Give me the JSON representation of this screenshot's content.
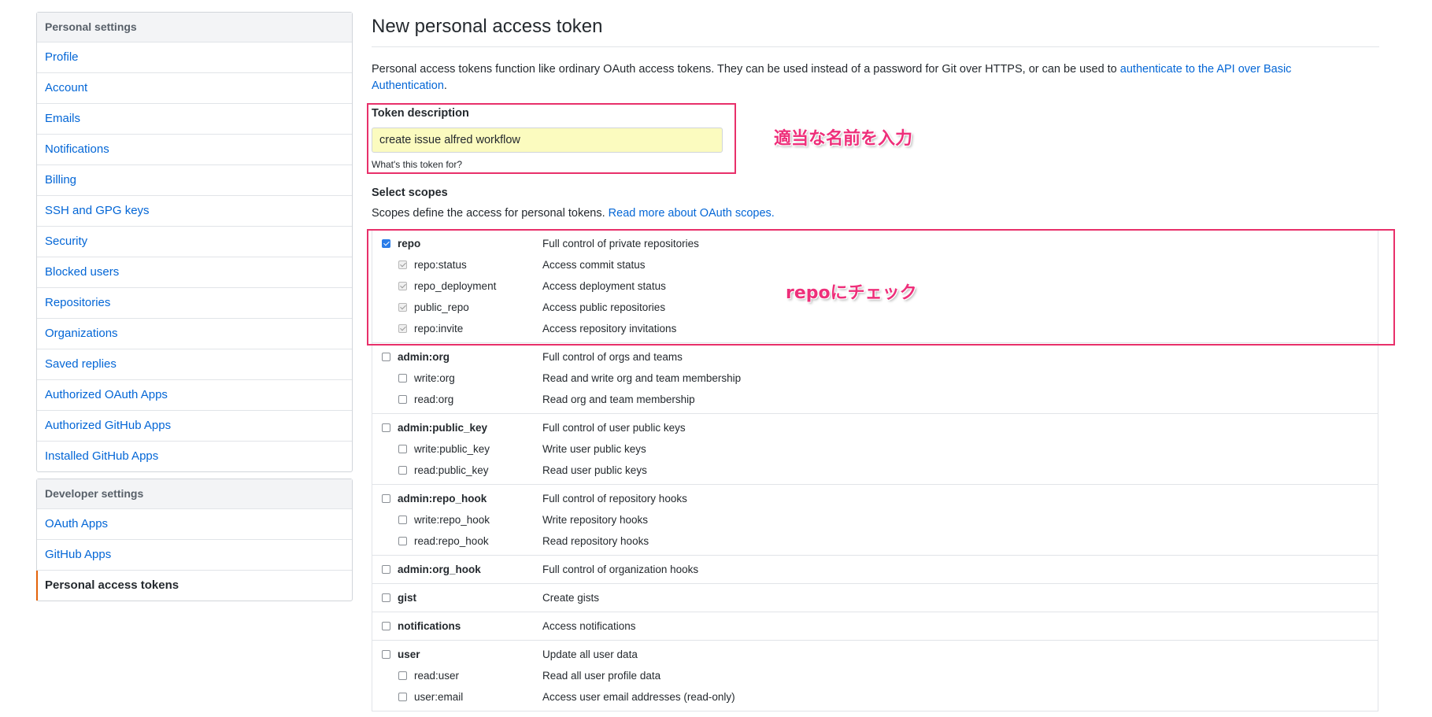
{
  "sidebar": {
    "personal_heading": "Personal settings",
    "personal_items": [
      {
        "label": "Profile"
      },
      {
        "label": "Account"
      },
      {
        "label": "Emails"
      },
      {
        "label": "Notifications"
      },
      {
        "label": "Billing"
      },
      {
        "label": "SSH and GPG keys"
      },
      {
        "label": "Security"
      },
      {
        "label": "Blocked users"
      },
      {
        "label": "Repositories"
      },
      {
        "label": "Organizations"
      },
      {
        "label": "Saved replies"
      },
      {
        "label": "Authorized OAuth Apps"
      },
      {
        "label": "Authorized GitHub Apps"
      },
      {
        "label": "Installed GitHub Apps"
      }
    ],
    "developer_heading": "Developer settings",
    "developer_items": [
      {
        "label": "OAuth Apps"
      },
      {
        "label": "GitHub Apps"
      },
      {
        "label": "Personal access tokens",
        "selected": true
      }
    ]
  },
  "main": {
    "title": "New personal access token",
    "intro_text": "Personal access tokens function like ordinary OAuth access tokens. They can be used instead of a password for Git over HTTPS, or can be used to ",
    "intro_link": "authenticate to the API over Basic Authentication",
    "intro_end": ".",
    "token_description_label": "Token description",
    "token_description_value": "create issue alfred workflow",
    "token_description_note": "What's this token for?",
    "select_scopes_label": "Select scopes",
    "scopes_desc": "Scopes define the access for personal tokens. ",
    "scopes_link": "Read more about OAuth scopes.",
    "scope_groups": [
      {
        "name": "repo",
        "desc": "Full control of private repositories",
        "checked": true,
        "children": [
          {
            "name": "repo:status",
            "desc": "Access commit status",
            "checked": true
          },
          {
            "name": "repo_deployment",
            "desc": "Access deployment status",
            "checked": true
          },
          {
            "name": "public_repo",
            "desc": "Access public repositories",
            "checked": true
          },
          {
            "name": "repo:invite",
            "desc": "Access repository invitations",
            "checked": true
          }
        ]
      },
      {
        "name": "admin:org",
        "desc": "Full control of orgs and teams",
        "checked": false,
        "children": [
          {
            "name": "write:org",
            "desc": "Read and write org and team membership",
            "checked": false
          },
          {
            "name": "read:org",
            "desc": "Read org and team membership",
            "checked": false
          }
        ]
      },
      {
        "name": "admin:public_key",
        "desc": "Full control of user public keys",
        "checked": false,
        "children": [
          {
            "name": "write:public_key",
            "desc": "Write user public keys",
            "checked": false
          },
          {
            "name": "read:public_key",
            "desc": "Read user public keys",
            "checked": false
          }
        ]
      },
      {
        "name": "admin:repo_hook",
        "desc": "Full control of repository hooks",
        "checked": false,
        "children": [
          {
            "name": "write:repo_hook",
            "desc": "Write repository hooks",
            "checked": false
          },
          {
            "name": "read:repo_hook",
            "desc": "Read repository hooks",
            "checked": false
          }
        ]
      },
      {
        "name": "admin:org_hook",
        "desc": "Full control of organization hooks",
        "checked": false,
        "children": []
      },
      {
        "name": "gist",
        "desc": "Create gists",
        "checked": false,
        "children": []
      },
      {
        "name": "notifications",
        "desc": "Access notifications",
        "checked": false,
        "children": []
      },
      {
        "name": "user",
        "desc": "Update all user data",
        "checked": false,
        "children": [
          {
            "name": "read:user",
            "desc": "Read all user profile data",
            "checked": false
          },
          {
            "name": "user:email",
            "desc": "Access user email addresses (read-only)",
            "checked": false
          }
        ]
      }
    ]
  },
  "annotations": {
    "name_hint": "適当な名前を入力",
    "repo_hint": "repoにチェック"
  },
  "colors": {
    "highlight": "#e8306a",
    "link": "#0366d6",
    "input_autofill": "#fbfbbf",
    "selected_marker": "#e36209"
  }
}
